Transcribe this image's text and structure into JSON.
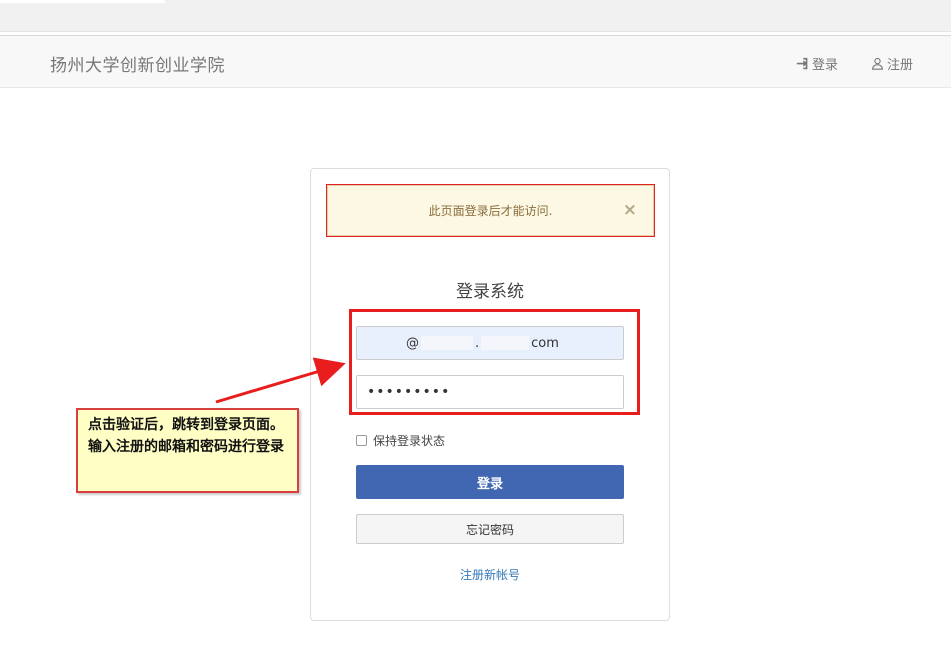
{
  "navbar": {
    "brand": "扬州大学创新创业学院",
    "login_label": "登录",
    "register_label": "注册"
  },
  "alert": {
    "message": "此页面登录后才能访问.",
    "close": "×"
  },
  "form": {
    "title": "登录系统",
    "email_prefix": "@",
    "email_dot": ".",
    "email_suffix": "com",
    "password_value": "•••••••••",
    "remember_label": "保持登录状态",
    "submit_label": "登录",
    "forgot_label": "忘记密码",
    "register_link": "注册新帐号"
  },
  "annotation": {
    "text": "点击验证后，跳转到登录页面。输入注册的邮箱和密码进行登录"
  },
  "colors": {
    "primary": "#4166b2",
    "alert_bg": "#fcf8e3",
    "annotation_border": "#e81e1e",
    "link": "#337ab7"
  }
}
